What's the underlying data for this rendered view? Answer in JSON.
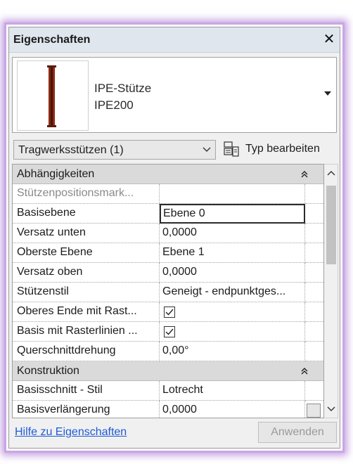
{
  "window": {
    "title": "Eigenschaften",
    "close_glyph": "✕"
  },
  "type_selector": {
    "family": "IPE-Stütze",
    "type": "IPE200"
  },
  "instance_filter": {
    "label": "Tragwerksstützen (1)"
  },
  "edit_type": {
    "label": "Typ bearbeiten"
  },
  "groups": [
    {
      "label": "Abhängigkeiten",
      "rows": [
        {
          "name": "Stützenpositionsmark...",
          "value": ""
        },
        {
          "name": "Basisebene",
          "value": "Ebene 0"
        },
        {
          "name": "Versatz unten",
          "value": "0,0000"
        },
        {
          "name": "Oberste Ebene",
          "value": "Ebene 1"
        },
        {
          "name": "Versatz oben",
          "value": "0,0000"
        },
        {
          "name": "Stützenstil",
          "value": "Geneigt - endpunktges..."
        },
        {
          "name": "Oberes Ende mit Rast...",
          "value": "",
          "checked": true
        },
        {
          "name": "Basis mit Rasterlinien ...",
          "value": "",
          "checked": true
        },
        {
          "name": "Querschnittdrehung",
          "value": "0,00°"
        }
      ]
    },
    {
      "label": "Konstruktion",
      "rows": [
        {
          "name": "Basisschnitt - Stil",
          "value": "Lotrecht"
        },
        {
          "name": "Basisverlängerung",
          "value": "0,0000"
        }
      ]
    }
  ],
  "footer": {
    "help_link": "Hilfe zu Eigenschaften",
    "apply_label": "Anwenden"
  },
  "colors": {
    "accent_glow": "#b07fe0",
    "link": "#1f5ad6",
    "column": "#8b2a14"
  },
  "icons": [
    "close-icon",
    "column-preview-icon",
    "dropdown-arrow-icon",
    "chevron-down-icon",
    "edit-type-icon",
    "collapse-group-icon",
    "checkbox-checked-icon",
    "scroll-up-icon",
    "scroll-down-icon"
  ]
}
